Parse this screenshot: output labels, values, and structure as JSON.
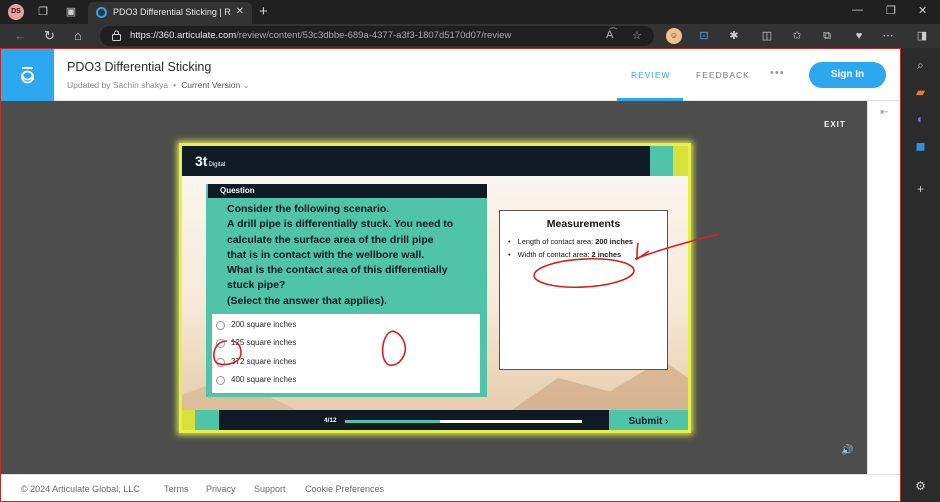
{
  "browser": {
    "profile_initials": "DS",
    "tab_title": "PDO3 Differential Sticking | Revie",
    "new_tab_symbol": "+",
    "url_host": "https://360.articulate.com",
    "url_path": "/review/content/53c3dbbe-689a-4377-a3f3-1807d5170d07/review",
    "icons": [
      "workspaces-icon",
      "tab-actions-icon",
      "back-icon",
      "refresh-icon",
      "home-icon",
      "lock-icon",
      "read-aloud-icon",
      "favorite-icon",
      "extensions-icon",
      "split-screen-icon",
      "favorites-icon",
      "collections-icon",
      "performance-icon",
      "more-icon"
    ]
  },
  "edge_sidebar": {
    "icons": [
      "search-icon",
      "tools-icon",
      "copilot-icon",
      "outlook-icon",
      "add-icon",
      "settings-icon"
    ]
  },
  "header": {
    "title": "PDO3 Differential Sticking",
    "updated_by": "Updated by Sachin shakya",
    "separator": "•",
    "version": "Current Version",
    "tabs": [
      {
        "label": "REVIEW",
        "active": true
      },
      {
        "label": "FEEDBACK",
        "active": false
      }
    ],
    "more": "•••",
    "signin": "Sign In",
    "accent_color": "#2da8ee"
  },
  "viewer": {
    "exit": "EXIT"
  },
  "slide": {
    "brand": "3t",
    "brand_sub": "Digital",
    "question_header": "Question",
    "question_lines": [
      "Consider the following scenario.",
      "A drill pipe is differentially stuck. You need to",
      "calculate the surface area of the drill pipe",
      "that is in contact with the wellbore wall.",
      "What is the contact area of this differentially",
      "stuck pipe?",
      "(Select the answer that applies)."
    ],
    "answers": [
      "200 square inches",
      "125 square inches",
      "372 square inches",
      "400 square inches"
    ],
    "measurements": {
      "title": "Measurements",
      "items": [
        {
          "label": "Length of contact area: ",
          "value": "200 inches"
        },
        {
          "label": "Width of contact area: ",
          "value": "2 inches"
        }
      ]
    },
    "progress": {
      "label": "4/12",
      "fraction": 0.4
    },
    "submit": "Submit ›",
    "colors": {
      "teal": "#4fc4a8",
      "navy": "#0f1b24",
      "lime": "#d6e23b",
      "annotation": "#d42020"
    }
  },
  "footer": {
    "copyright": "© 2024 Articulate Global, LLC",
    "links": [
      "Terms",
      "Privacy",
      "Support",
      "Cookie Preferences"
    ]
  }
}
